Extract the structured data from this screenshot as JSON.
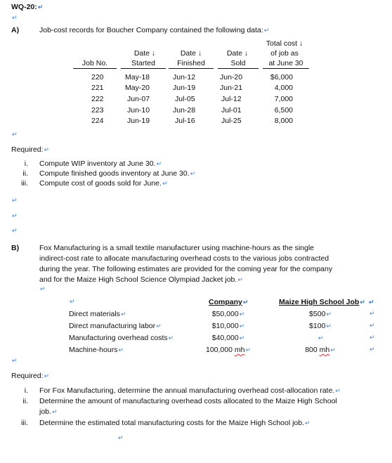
{
  "title": "WQ-20:",
  "paragraph_mark": "↵",
  "part_a": {
    "label": "A)",
    "intro": "Job-cost records for Boucher Company contained the following data:",
    "table": {
      "headers": [
        {
          "line1": "",
          "line2": "",
          "line3": "Job No."
        },
        {
          "line1": "",
          "line2": "Date ↓",
          "line3": "Started"
        },
        {
          "line1": "",
          "line2": "Date ↓",
          "line3": "Finished"
        },
        {
          "line1": "",
          "line2": "Date ↓",
          "line3": "Sold"
        },
        {
          "line1": "Total cost ↓",
          "line2": "of job as",
          "line3": "at June 30"
        }
      ],
      "rows": [
        {
          "job": "220",
          "started": "May-18",
          "finished": "Jun-12",
          "sold": "Jun-20",
          "cost": "$6,000"
        },
        {
          "job": "221",
          "started": "May-20",
          "finished": "Jun-19",
          "sold": "Jun-21",
          "cost": "4,000"
        },
        {
          "job": "222",
          "started": "Jun-07",
          "finished": "Jul-05",
          "sold": "Jul-12",
          "cost": "7,000"
        },
        {
          "job": "223",
          "started": "Jun-10",
          "finished": "Jun-28",
          "sold": "Jul-01",
          "cost": "6,500"
        },
        {
          "job": "224",
          "started": "Jun-19",
          "finished": "Jul-16",
          "sold": "Jul-25",
          "cost": "8,000"
        }
      ]
    },
    "required_label": "Required:",
    "required": [
      {
        "num": "i.",
        "text": "Compute WIP inventory at June 30."
      },
      {
        "num": "ii.",
        "text": "Compute finished goods inventory at June 30."
      },
      {
        "num": "iii.",
        "text": "Compute cost of goods sold for June."
      }
    ]
  },
  "part_b": {
    "label": "B)",
    "intro_lines": [
      "Fox Manufacturing is a small textile manufacturer using machine-hours as the single",
      "indirect-cost rate to allocate manufacturing overhead costs to the various jobs contracted",
      "during the year. The following estimates are provided for the coming year for the company",
      "and for the Maize High School Science Olympiad Jacket job."
    ],
    "table": {
      "col_company": "Company",
      "col_job": "Maize High School Job",
      "rows": [
        {
          "label": "Direct materials",
          "company": "$50,000",
          "job": "$500"
        },
        {
          "label": "Direct manufacturing labor",
          "company": "$10,000",
          "job": "$100"
        },
        {
          "label": "Manufacturing overhead costs",
          "company": "$40,000",
          "job": ""
        },
        {
          "label": "Machine-hours",
          "company": "100,000",
          "company_unit": "mh",
          "job": "800",
          "job_unit": "mh"
        }
      ]
    },
    "required_label": "Required:",
    "required": [
      {
        "num": "i.",
        "lines": [
          "For Fox Manufacturing, determine the annual manufacturing overhead cost-allocation rate."
        ]
      },
      {
        "num": "ii.",
        "lines": [
          "Determine the amount of manufacturing overhead costs allocated to the Maize High School",
          "job."
        ]
      },
      {
        "num": "iii.",
        "lines": [
          "Determine the estimated total manufacturing costs for the Maize High School job."
        ]
      }
    ]
  }
}
